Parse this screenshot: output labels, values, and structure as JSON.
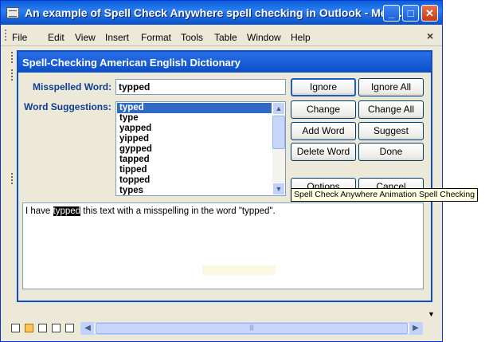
{
  "outer_window": {
    "title": "An example of Spell Check Anywhere spell checking in Outlook - Mess...",
    "min_glyph": "_",
    "max_glyph": "□",
    "close_glyph": "✕",
    "menu": [
      "File",
      "Edit",
      "View",
      "Insert",
      "Format",
      "Tools",
      "Table",
      "Window",
      "Help"
    ],
    "menu_close_glyph": "×"
  },
  "dialog": {
    "title": "Spell-Checking American English Dictionary",
    "misspelled_label": "Misspelled Word:",
    "misspelled_value": "typped",
    "suggestions_label": "Word Suggestions:",
    "suggestions": [
      "typed",
      "type",
      "yapped",
      "yipped",
      "gypped",
      "tapped",
      "tipped",
      "topped",
      "types"
    ],
    "selected_suggestion": "typed",
    "buttons": {
      "ignore": "Ignore",
      "ignore_all": "Ignore All",
      "change": "Change",
      "change_all": "Change All",
      "add_word": "Add Word",
      "suggest": "Suggest",
      "delete_word": "Delete Word",
      "done": "Done",
      "options": "Options",
      "cancel": "Cancel"
    },
    "context_text": {
      "before": "I have ",
      "highlight": "typped",
      "after": " this text with a misspelling in the word \"typped\"."
    }
  },
  "tooltip": "Spell Check Anywhere Animation Spell Checking",
  "colors": {
    "title_bar": "#0a4fc8",
    "label_blue": "#0e3e94",
    "selection": "#316ac5",
    "tooltip_bg": "#ffffe1"
  }
}
